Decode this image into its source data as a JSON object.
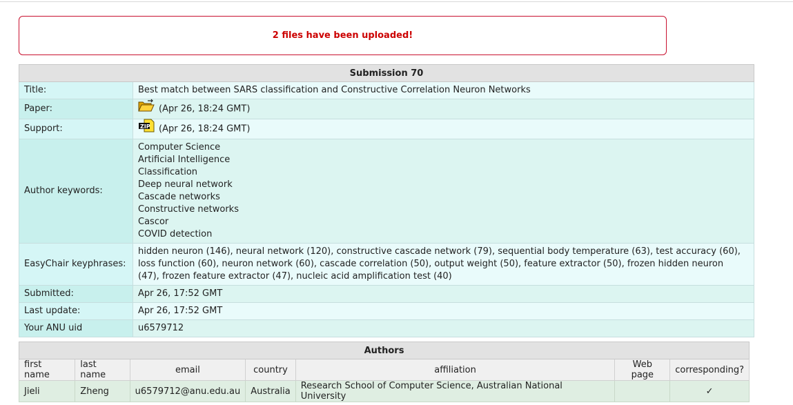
{
  "alert": {
    "message": "2 files have been uploaded!"
  },
  "submission": {
    "heading": "Submission 70",
    "title_label": "Title:",
    "title": "Best match between SARS classification and Constructive Correlation Neuron Networks",
    "paper_label": "Paper:",
    "paper_time": "(Apr 26, 18:24 GMT)",
    "paper_icon": "folder-open-icon",
    "support_label": "Support:",
    "support_time": "(Apr 26, 18:24 GMT)",
    "support_icon": "zip-file-icon",
    "keywords_label": "Author keywords:",
    "keywords": [
      "Computer Science",
      "Artificial Intelligence",
      "Classification",
      "Deep neural network",
      "Cascade networks",
      "Constructive networks",
      "Cascor",
      "COVID detection"
    ],
    "keyphrases_label": "EasyChair keyphrases:",
    "keyphrases_lines": [
      "hidden neuron (146), neural network (120), constructive cascade network (79), sequential body temperature (63), test accuracy (60),",
      "loss function (60), neuron network (60), cascade correlation (50), output weight (50), feature extractor (50), frozen hidden neuron",
      "(47), frozen feature extractor (47), nucleic acid amplification test (40)"
    ],
    "submitted_label": "Submitted:",
    "submitted": "Apr 26, 17:52 GMT",
    "last_update_label": "Last update:",
    "last_update": "Apr 26, 17:52 GMT",
    "uid_label": "Your ANU uid",
    "uid": "u6579712"
  },
  "authors": {
    "heading": "Authors",
    "columns": [
      "first name",
      "last name",
      "email",
      "country",
      "affiliation",
      "Web page",
      "corresponding?"
    ],
    "rows": [
      {
        "first_name": "Jieli",
        "last_name": "Zheng",
        "email": "u6579712@anu.edu.au",
        "country": "Australia",
        "affiliation": "Research School of Computer Science, Australian National University",
        "web_page": "",
        "corresponding": "✓"
      }
    ]
  },
  "colors": {
    "alert_border": "#c8102e",
    "alert_text": "#cc0000",
    "header_bg": "#e2e2e2",
    "row_light": "#e9fbfb",
    "row_dark": "#dcf5f1",
    "author_row": "#dfeee2"
  }
}
